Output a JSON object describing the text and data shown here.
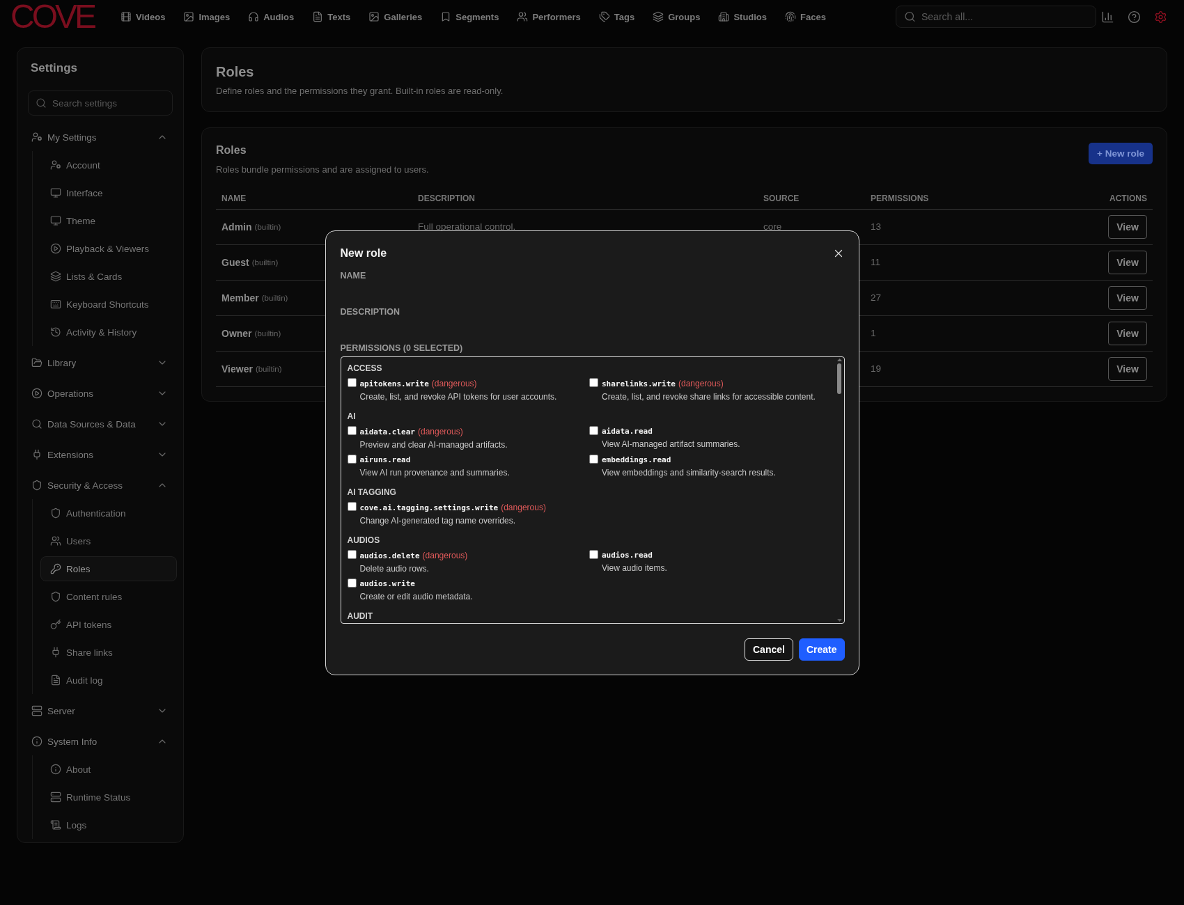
{
  "nav": {
    "logo": "COVE",
    "items": [
      {
        "label": "Videos"
      },
      {
        "label": "Images"
      },
      {
        "label": "Audios"
      },
      {
        "label": "Texts"
      },
      {
        "label": "Galleries"
      },
      {
        "label": "Segments"
      },
      {
        "label": "Performers"
      },
      {
        "label": "Tags"
      },
      {
        "label": "Groups"
      },
      {
        "label": "Studios"
      },
      {
        "label": "Faces"
      }
    ],
    "search": {
      "placeholder": "Search all..."
    }
  },
  "sidebar": {
    "title": "Settings",
    "search": {
      "placeholder": "Search settings"
    },
    "groups": [
      {
        "label": "My Settings",
        "expanded": true,
        "children": [
          {
            "label": "Account",
            "selected": false
          },
          {
            "label": "Interface",
            "selected": false
          },
          {
            "label": "Theme",
            "selected": false
          },
          {
            "label": "Playback & Viewers",
            "selected": false
          },
          {
            "label": "Lists & Cards",
            "selected": false
          },
          {
            "label": "Keyboard Shortcuts",
            "selected": false
          },
          {
            "label": "Activity & History",
            "selected": false
          }
        ]
      },
      {
        "label": "Library",
        "expanded": false
      },
      {
        "label": "Operations",
        "expanded": false
      },
      {
        "label": "Data Sources & Data",
        "expanded": false
      },
      {
        "label": "Extensions",
        "expanded": false
      },
      {
        "label": "Security & Access",
        "expanded": true,
        "children": [
          {
            "label": "Authentication",
            "selected": false
          },
          {
            "label": "Users",
            "selected": false
          },
          {
            "label": "Roles",
            "selected": true
          },
          {
            "label": "Content rules",
            "selected": false
          },
          {
            "label": "API tokens",
            "selected": false
          },
          {
            "label": "Share links",
            "selected": false
          },
          {
            "label": "Audit log",
            "selected": false
          }
        ]
      },
      {
        "label": "Server",
        "expanded": false
      },
      {
        "label": "System Info",
        "expanded": true,
        "children": [
          {
            "label": "About",
            "selected": false
          },
          {
            "label": "Runtime Status",
            "selected": false
          },
          {
            "label": "Logs",
            "selected": false
          }
        ]
      }
    ]
  },
  "page_header": {
    "title": "Roles",
    "subtitle": "Define roles and the permissions they grant. Built-in roles are read-only."
  },
  "roles_card": {
    "title": "Roles",
    "subtitle": "Roles bundle permissions and are assigned to users.",
    "new_button": "+ New role",
    "table": {
      "columns": [
        "NAME",
        "DESCRIPTION",
        "SOURCE",
        "PERMISSIONS",
        "ACTIONS"
      ],
      "rows": [
        {
          "name": "Admin",
          "tag": "(builtin)",
          "description": "Full operational control.",
          "source": "core",
          "permissions": "13",
          "action": "View"
        },
        {
          "name": "Guest",
          "tag": "(builtin)",
          "permissions": "11",
          "action": "View"
        },
        {
          "name": "Member",
          "tag": "(builtin)",
          "permissions": "27",
          "action": "View"
        },
        {
          "name": "Owner",
          "tag": "(builtin)",
          "permissions": "1",
          "action": "View"
        },
        {
          "name": "Viewer",
          "tag": "(builtin)",
          "permissions": "19",
          "action": "View"
        }
      ]
    }
  },
  "dialog": {
    "title": "New role",
    "fields": [
      {
        "label": "NAME"
      },
      {
        "label": "DESCRIPTION"
      }
    ],
    "permissions_label": "PERMISSIONS (0 SELECTED)",
    "groups": [
      {
        "heading": "ACCESS",
        "items": [
          {
            "key": "apitokens.write",
            "tag": "(dangerous)",
            "description": "Create, list, and revoke API tokens for user accounts.",
            "checked": false
          },
          {
            "key": "sharelinks.write",
            "tag": "(dangerous)",
            "description": "Create, list, and revoke share links for accessible content.",
            "checked": false
          }
        ]
      },
      {
        "heading": "AI",
        "items": [
          {
            "key": "aidata.clear",
            "tag": "(dangerous)",
            "description": "Preview and clear AI-managed artifacts.",
            "checked": false
          },
          {
            "key": "aidata.read",
            "description": "View AI-managed artifact summaries.",
            "checked": false
          },
          {
            "key": "airuns.read",
            "description": "View AI run provenance and summaries.",
            "checked": false
          },
          {
            "key": "embeddings.read",
            "description": "View embeddings and similarity-search results.",
            "checked": false
          }
        ]
      },
      {
        "heading": "AI TAGGING",
        "items": [
          {
            "key": "cove.ai.tagging.settings.write",
            "tag": "(dangerous)",
            "description": "Change AI-generated tag name overrides.",
            "checked": false
          }
        ]
      },
      {
        "heading": "AUDIOS",
        "items": [
          {
            "key": "audios.delete",
            "tag": "(dangerous)",
            "description": "Delete audio rows.",
            "checked": false
          },
          {
            "key": "audios.read",
            "description": "View audio items.",
            "checked": false
          },
          {
            "key": "audios.write",
            "description": "Create or edit audio metadata.",
            "checked": false
          }
        ]
      },
      {
        "heading": "AUDIT"
      }
    ],
    "buttons": [
      {
        "label": "Cancel",
        "kind": "secondary"
      },
      {
        "label": "Create",
        "kind": "primary"
      }
    ]
  }
}
